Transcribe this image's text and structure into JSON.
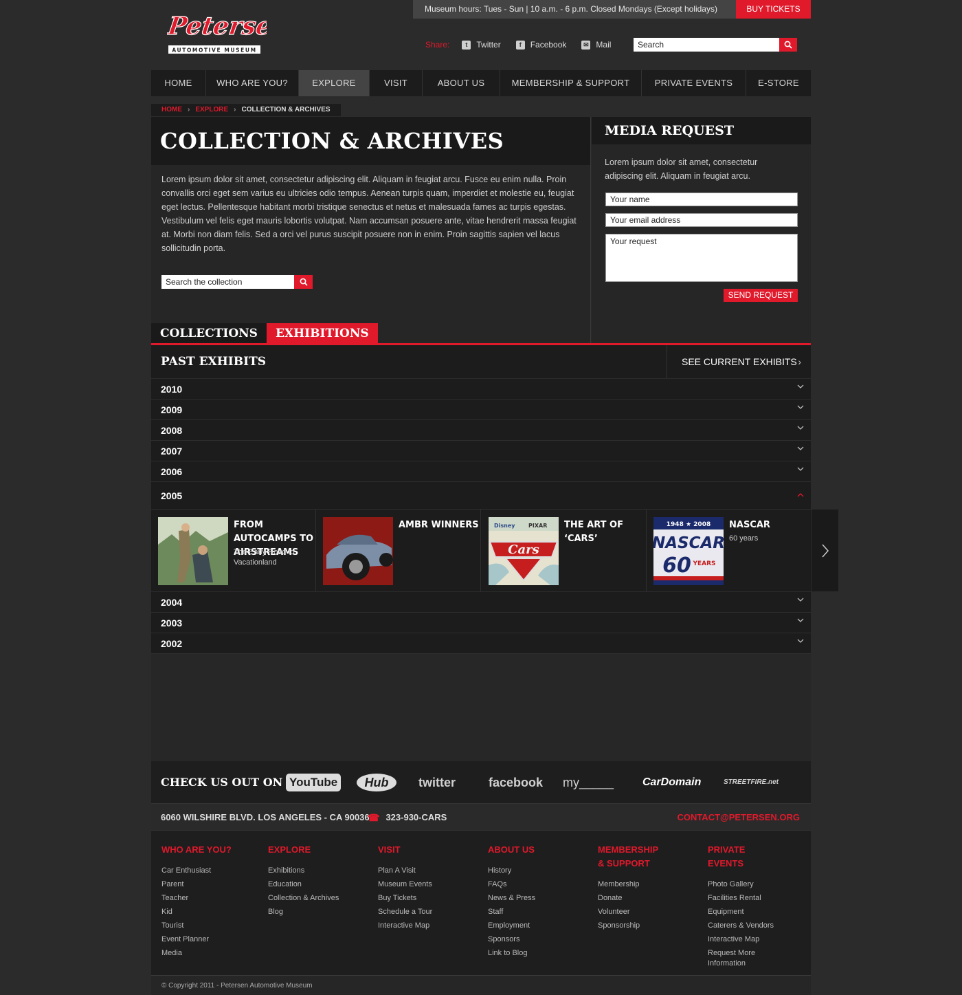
{
  "header": {
    "logo_text": "Petersen",
    "logo_sub": "AUTOMOTIVE MUSEUM",
    "hours": "Museum hours: Tues - Sun | 10 a.m. - 6 p.m. Closed Mondays (Except holidays)",
    "buy_tickets": "BUY TICKETS",
    "share_label": "Share:",
    "share": [
      "Twitter",
      "Facebook",
      "Mail"
    ],
    "search_placeholder": "Search"
  },
  "nav": [
    "HOME",
    "WHO ARE YOU?",
    "EXPLORE",
    "VISIT",
    "ABOUT US",
    "MEMBERSHIP & SUPPORT",
    "PRIVATE EVENTS",
    "E-STORE"
  ],
  "nav_active": "EXPLORE",
  "breadcrumb": [
    "HOME",
    "EXPLORE",
    "COLLECTION & ARCHIVES"
  ],
  "main": {
    "title": "COLLECTION & ARCHIVES",
    "intro": "Lorem ipsum dolor sit amet, consectetur adipiscing elit. Aliquam in feugiat arcu. Fusce eu enim nulla. Proin convallis orci eget sem varius eu ultricies odio tempus. Aenean turpis quam, imperdiet et molestie eu, feugiat eget lectus. Pellentesque habitant morbi tristique senectus et netus et malesuada fames ac turpis egestas. Vestibulum vel felis eget mauris lobortis volutpat. Nam accumsan posuere ante, vitae hendrerit massa feugiat at. Morbi non diam felis. Sed a orci vel purus suscipit posuere non in enim. Proin sagittis sapien vel lacus sollicitudin porta.",
    "search_placeholder": "Search the collection",
    "tabs": [
      "COLLECTIONS",
      "EXHIBITIONS"
    ]
  },
  "media": {
    "title": "MEDIA REQUEST",
    "text": "Lorem ipsum dolor sit amet, consectetur adipiscing elit. Aliquam in feugiat arcu.",
    "name_placeholder": "Your name",
    "email_placeholder": "Your email address",
    "request_placeholder": "Your request",
    "send": "SEND REQUEST"
  },
  "past": {
    "title": "PAST EXHIBITS",
    "see_current": "SEE CURRENT EXHIBITS",
    "years_top": [
      "2010",
      "2009",
      "2008",
      "2007",
      "2006"
    ],
    "open_year": "2005",
    "years_bottom": [
      "2004",
      "2003",
      "2002"
    ],
    "exhibits": [
      {
        "title": "FROM AUTOCAMPS TO AIRSTREAMS",
        "subtitle": "The Early Road to Vacationland"
      },
      {
        "title": "AMBR WINNERS",
        "subtitle": ""
      },
      {
        "title": "THE ART OF ‘CARS’",
        "subtitle": ""
      },
      {
        "title": "NASCAR",
        "subtitle": "60 years"
      }
    ],
    "thumb_text": {
      "cars": "Cars",
      "disney": "Disney",
      "pixar": "PIXAR",
      "nascar_years": "1948 ★ 2008",
      "nascar": "NASCAR",
      "sixty": "60",
      "years": "YEARS"
    }
  },
  "social": {
    "title": "CHECK US OUT ON",
    "logos": [
      "YouTube",
      "Hub",
      "twitter",
      "facebook",
      "my_____",
      "CarDomain",
      "STREETFIRE.net"
    ]
  },
  "contact": {
    "address": "6060 WILSHIRE BLVD. LOS ANGELES - CA 90036",
    "phone": "323-930-CARS",
    "email": "CONTACT@PETERSEN.ORG"
  },
  "footer": {
    "columns": [
      {
        "head": "WHO ARE YOU?",
        "links": [
          "Car Enthusiast",
          "Parent",
          "Teacher",
          "Kid",
          "Tourist",
          "Event Planner",
          "Media"
        ]
      },
      {
        "head": "EXPLORE",
        "links": [
          "Exhibitions",
          "Education",
          "Collection & Archives",
          "Blog"
        ]
      },
      {
        "head": "VISIT",
        "links": [
          "Plan A Visit",
          "Museum Events",
          "Buy Tickets",
          "Schedule a Tour",
          "Interactive Map"
        ]
      },
      {
        "head": "ABOUT US",
        "links": [
          "History",
          "FAQs",
          "News & Press",
          "Staff",
          "Employment",
          "Sponsors",
          "Link to Blog"
        ]
      },
      {
        "head": "MEMBERSHIP & SUPPORT",
        "links": [
          "Membership",
          "Donate",
          "Volunteer",
          "Sponsorship"
        ]
      },
      {
        "head": "PRIVATE EVENTS",
        "links": [
          "Photo Gallery",
          "Facilities Rental",
          "Equipment",
          "Caterers & Vendors",
          "Interactive Map",
          "Request More Information"
        ]
      }
    ],
    "copyright": "© Copyright 2011 - Petersen Automotive Museum"
  },
  "colors": {
    "accent": "#e0192b",
    "background": "#2b2b2b",
    "panel": "#1c1c1c"
  }
}
